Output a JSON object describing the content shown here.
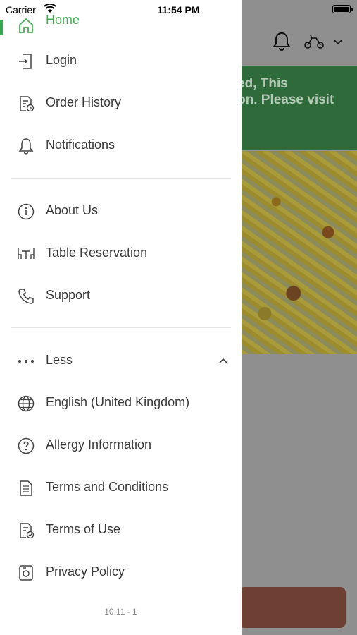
{
  "status_bar": {
    "carrier": "Carrier",
    "time": "11:54 PM"
  },
  "background_screen": {
    "banner_text": "ed, This\non. Please visit\n"
  },
  "drawer": {
    "home_label": "Home",
    "items": [
      {
        "label": "Login",
        "icon": "login-icon"
      },
      {
        "label": "Order History",
        "icon": "order-history-icon"
      },
      {
        "label": "Notifications",
        "icon": "bell-icon"
      },
      {
        "label": "About Us",
        "icon": "info-icon"
      },
      {
        "label": "Table Reservation",
        "icon": "table-chairs-icon"
      },
      {
        "label": "Support",
        "icon": "phone-icon"
      },
      {
        "label": "Less",
        "icon": "more-dots-icon"
      },
      {
        "label": "English (United Kingdom)",
        "icon": "globe-icon"
      },
      {
        "label": "Allergy Information",
        "icon": "question-icon"
      },
      {
        "label": "Terms and Conditions",
        "icon": "document-icon"
      },
      {
        "label": "Terms of Use",
        "icon": "document-check-icon"
      },
      {
        "label": "Privacy Policy",
        "icon": "privacy-icon"
      }
    ],
    "version": "10.11 - 1"
  },
  "colors": {
    "accent_green": "#4aa95b",
    "banner_green": "#2f6a3a",
    "footer_button": "#6e3f33",
    "text": "#3a3a3a"
  }
}
